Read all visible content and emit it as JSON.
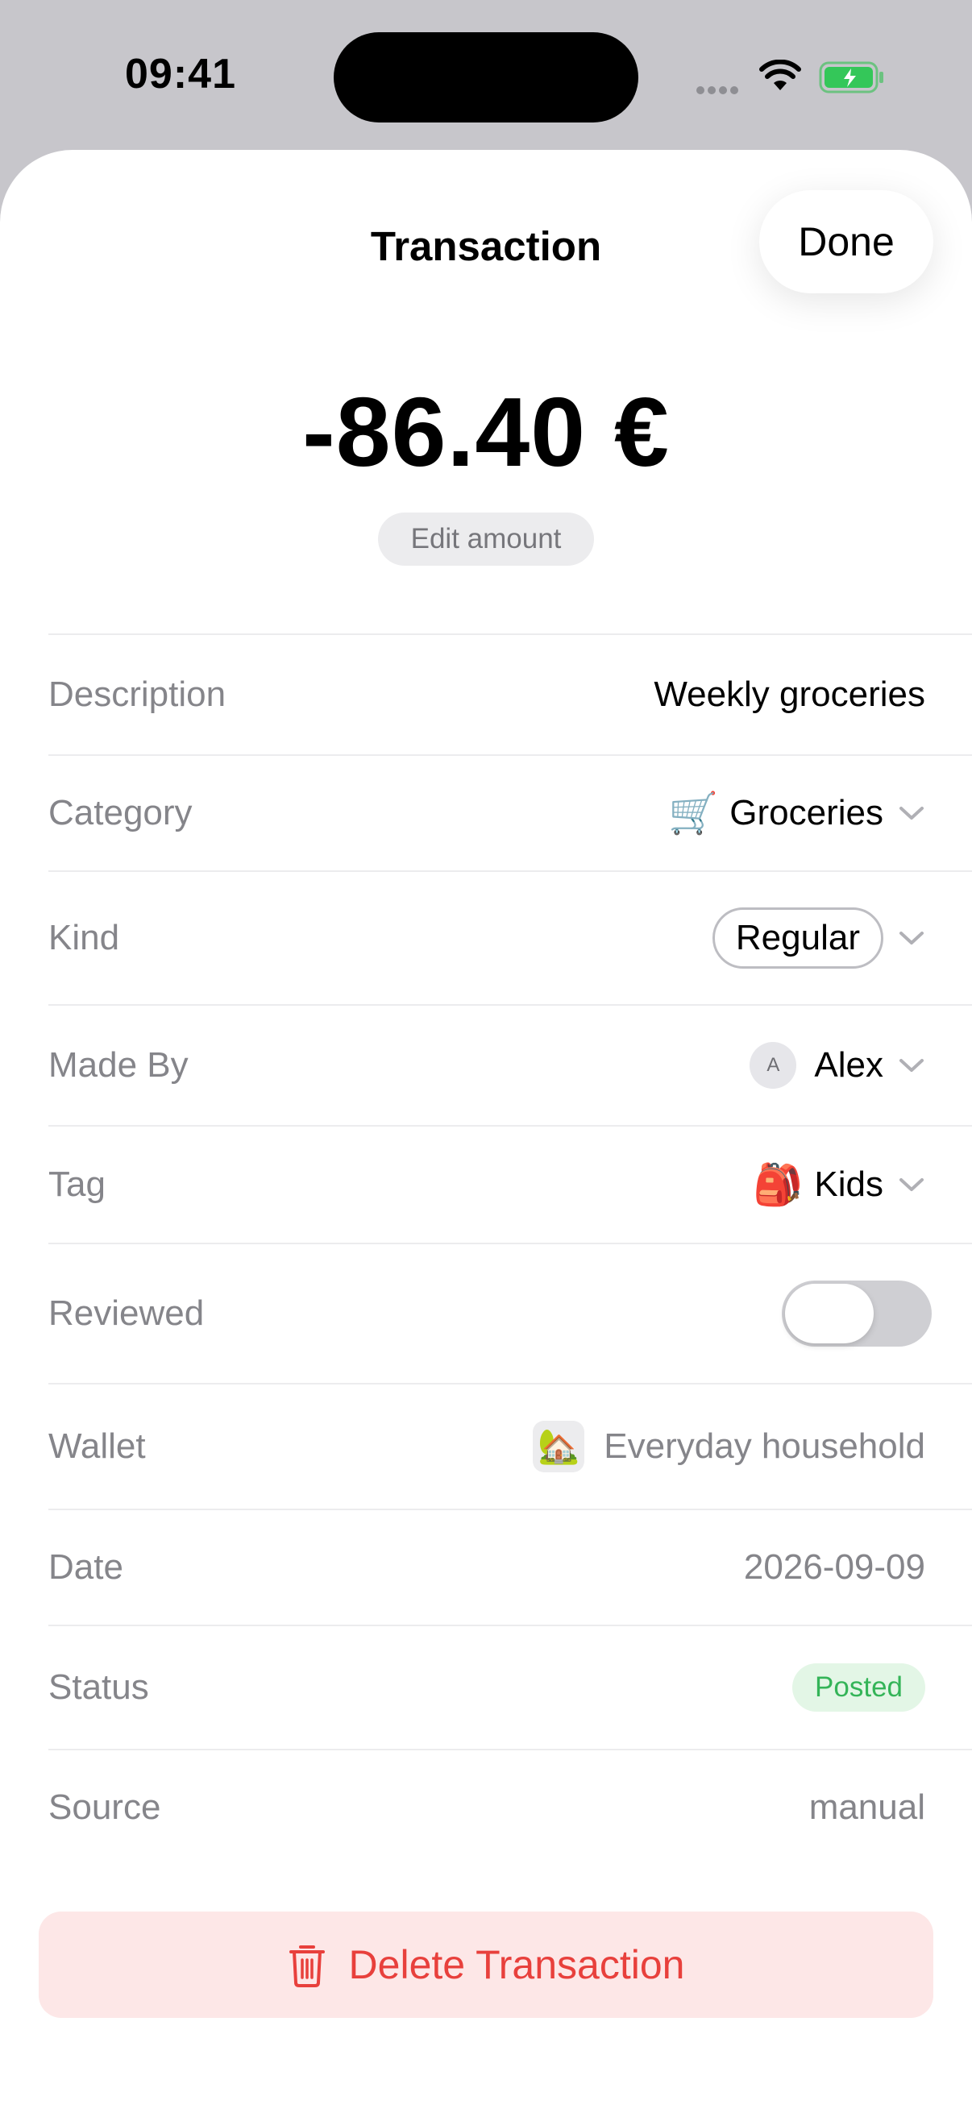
{
  "status_bar": {
    "time": "09:41"
  },
  "nav": {
    "title": "Transaction",
    "done_label": "Done"
  },
  "amount": {
    "display": "-86.40 €",
    "edit_label": "Edit amount"
  },
  "fields": {
    "description": {
      "label": "Description",
      "value": "Weekly groceries"
    },
    "category": {
      "label": "Category",
      "emoji": "🛒",
      "value": "Groceries"
    },
    "kind": {
      "label": "Kind",
      "value": "Regular"
    },
    "made_by": {
      "label": "Made By",
      "avatar_initial": "A",
      "value": "Alex"
    },
    "tag": {
      "label": "Tag",
      "emoji": "🎒",
      "value": "Kids"
    },
    "reviewed": {
      "label": "Reviewed",
      "on": false
    },
    "wallet": {
      "label": "Wallet",
      "emoji": "🏡",
      "value": "Everyday household"
    },
    "date": {
      "label": "Date",
      "value": "2026-09-09"
    },
    "status": {
      "label": "Status",
      "value": "Posted",
      "color": "#34b458"
    },
    "source": {
      "label": "Source",
      "value": "manual"
    }
  },
  "delete": {
    "label": "Delete Transaction",
    "color": "#e8403c"
  },
  "icons": [
    "wifi-icon",
    "battery-charging-icon",
    "chevron-down-icon",
    "trash-icon"
  ]
}
